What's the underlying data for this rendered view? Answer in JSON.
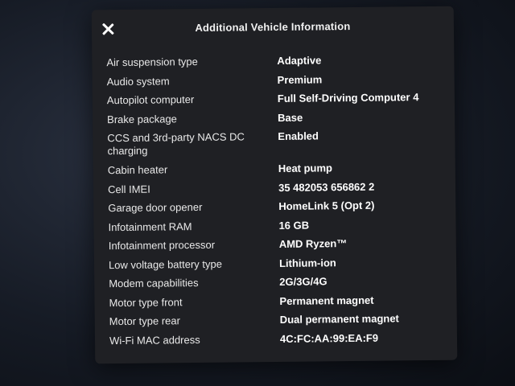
{
  "dialog": {
    "title": "Additional Vehicle Information",
    "close_icon": "close-icon"
  },
  "info_rows": [
    {
      "label": "Air suspension type",
      "value": "Adaptive"
    },
    {
      "label": "Audio system",
      "value": "Premium"
    },
    {
      "label": "Autopilot computer",
      "value": "Full Self-Driving Computer 4"
    },
    {
      "label": "Brake package",
      "value": "Base"
    },
    {
      "label": "CCS and 3rd-party NACS DC charging",
      "value": "Enabled"
    },
    {
      "label": "Cabin heater",
      "value": "Heat pump"
    },
    {
      "label": "Cell IMEI",
      "value": "35 482053 656862 2"
    },
    {
      "label": "Garage door opener",
      "value": "HomeLink 5 (Opt 2)"
    },
    {
      "label": "Infotainment RAM",
      "value": "16 GB"
    },
    {
      "label": "Infotainment processor",
      "value": "AMD Ryzen™"
    },
    {
      "label": "Low voltage battery type",
      "value": "Lithium-ion"
    },
    {
      "label": "Modem capabilities",
      "value": "2G/3G/4G"
    },
    {
      "label": "Motor type front",
      "value": "Permanent magnet"
    },
    {
      "label": "Motor type rear",
      "value": "Dual permanent magnet"
    },
    {
      "label": "Wi-Fi MAC address",
      "value": "4C:FC:AA:99:EA:F9"
    }
  ]
}
